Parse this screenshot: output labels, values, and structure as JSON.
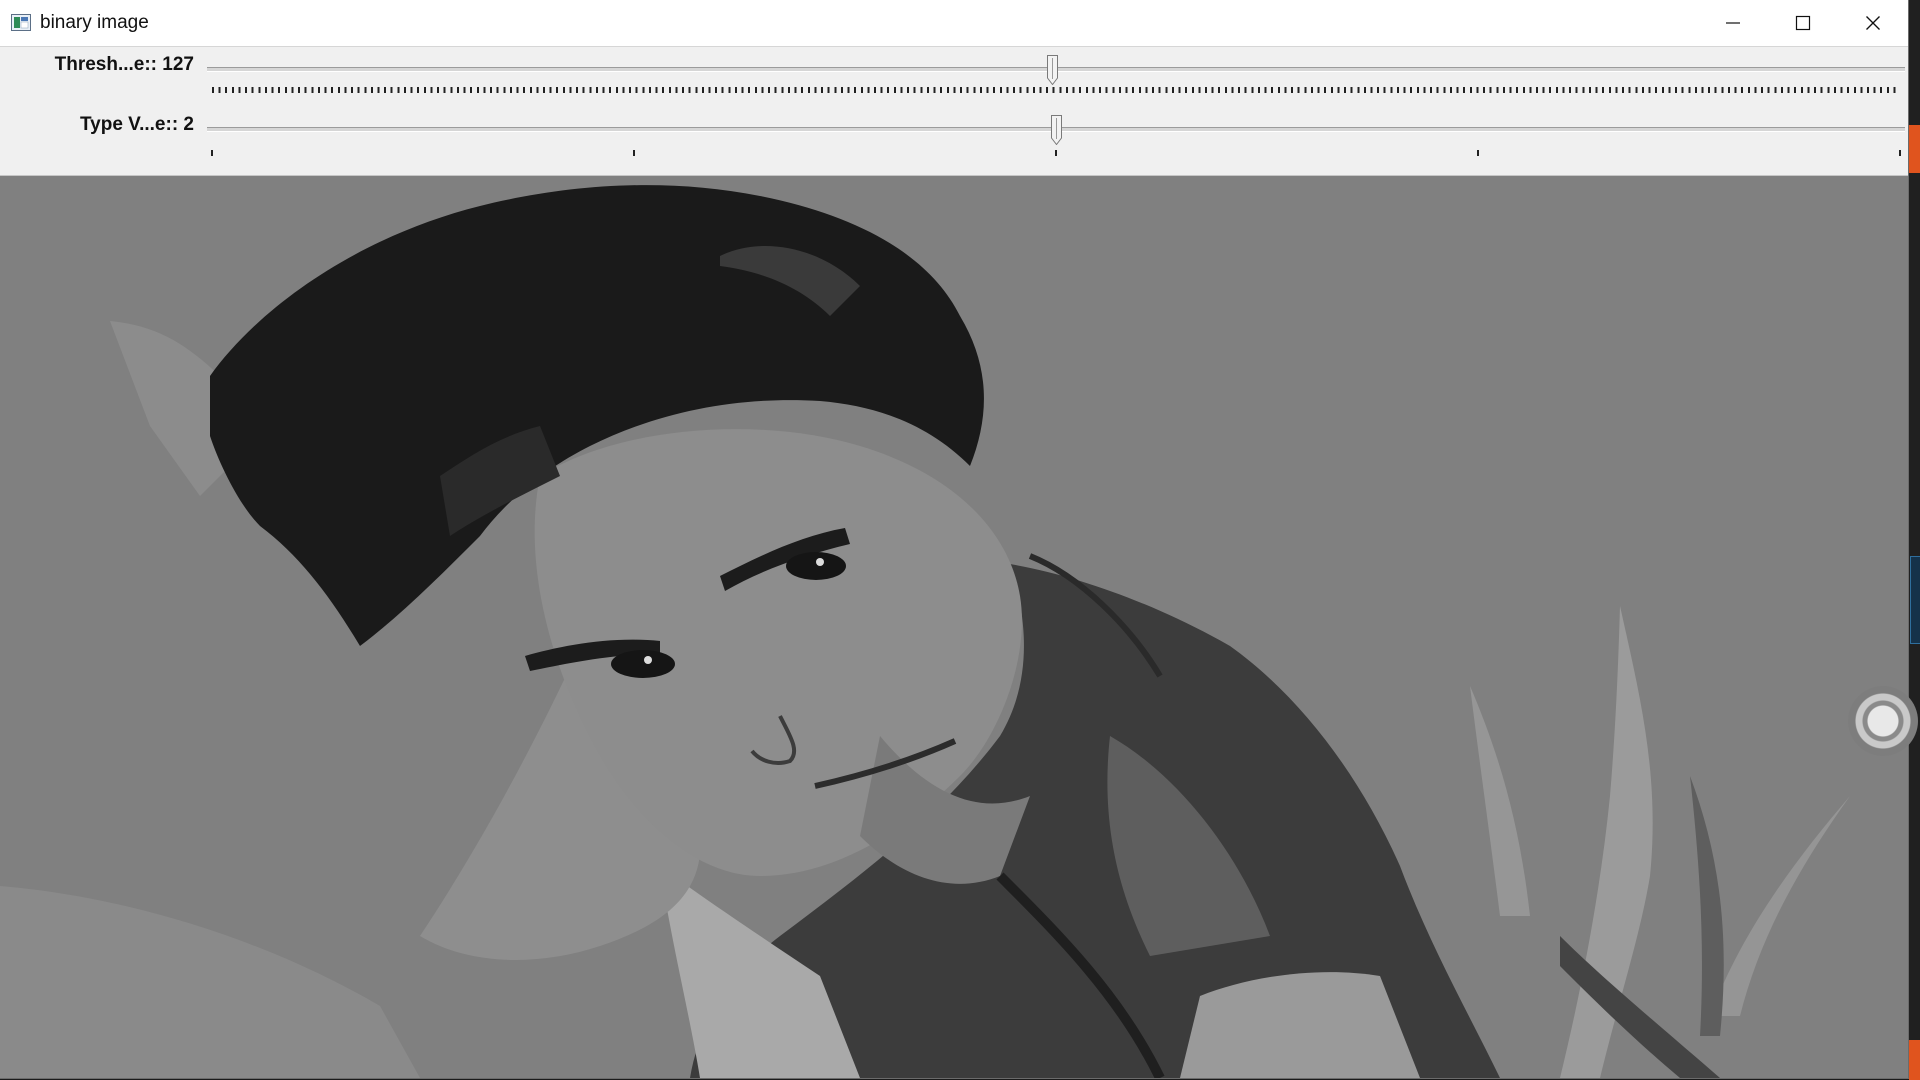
{
  "window": {
    "title": "binary image",
    "icon": "opencv-window-icon",
    "controls": {
      "minimize_icon": "minimize-icon",
      "maximize_icon": "maximize-icon",
      "close_icon": "close-icon"
    }
  },
  "trackbars": [
    {
      "label": "Thresh...e:: 127",
      "value": 127,
      "max": 255,
      "fraction": 0.498
    },
    {
      "label": "Type V...e:: 2",
      "value": 2,
      "max": 4,
      "fraction": 0.5
    }
  ],
  "image": {
    "description_icon": "grayscale-thresholded-photo",
    "background_gray": "#808080"
  },
  "colors": {
    "titlebar": "#ffffff",
    "panel": "#f0f0f0",
    "accent_strip": "#e0541e"
  },
  "overlay": {
    "floating_button_icon": "assistive-touch-icon"
  }
}
